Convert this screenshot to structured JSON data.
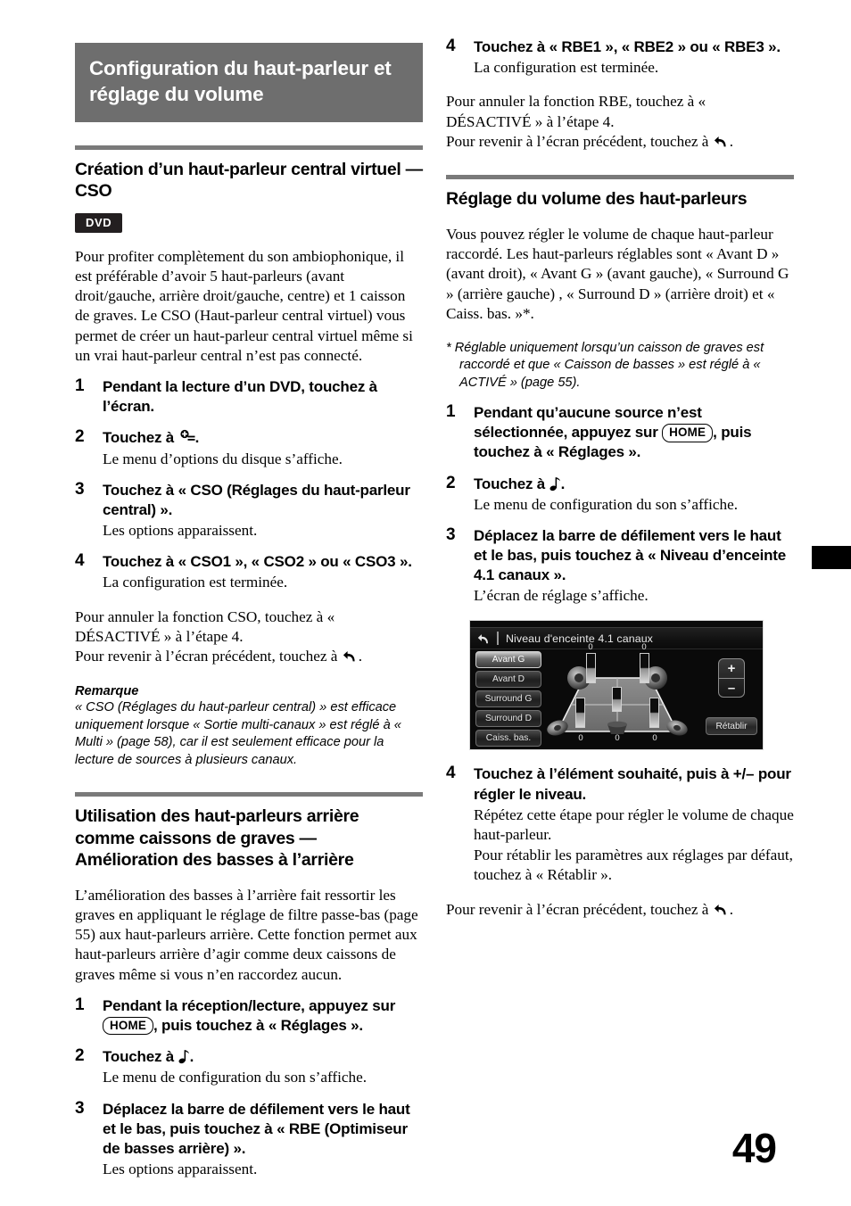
{
  "banner": {
    "title": "Configuration du haut-parleur et réglage du volume"
  },
  "left_column": {
    "section1": {
      "heading": "Création d’un haut-parleur central virtuel — CSO",
      "badge": "DVD",
      "intro": "Pour profiter complètement du son ambiophonique, il est préférable d’avoir 5 haut-parleurs (avant droit/gauche, arrière droit/gauche, centre) et 1 caisson de graves. Le CSO (Haut-parleur central virtuel) vous permet de créer un haut-parleur central virtuel même si un vrai haut-parleur central n’est pas connecté.",
      "steps": [
        {
          "num": "1",
          "lead": "Pendant la lecture d’un DVD, touchez à l’écran.",
          "sub": ""
        },
        {
          "num": "2",
          "lead_pre": "Touchez à",
          "lead_post": ".",
          "icon": "options-icon",
          "sub": "Le menu d’options du disque s’affiche."
        },
        {
          "num": "3",
          "lead": "Touchez à « CSO (Réglages du haut-parleur central) ».",
          "sub": "Les options apparaissent."
        },
        {
          "num": "4",
          "lead": "Touchez à « CSO1 », « CSO2 » ou « CSO3 ».",
          "sub": "La configuration est terminée."
        }
      ],
      "after_1": "Pour annuler la fonction CSO, touchez à « DÉSACTIVÉ » à l’étape 4.",
      "after_2_pre": "Pour revenir à l’écran précédent, touchez à",
      "after_2_post": ".",
      "note_title": "Remarque",
      "note_body": "« CSO (Réglages du haut-parleur central) » est efficace uniquement lorsque « Sortie multi-canaux » est réglé à « Multi » (page 58), car il est seulement efficace pour la lecture de sources à plusieurs canaux."
    },
    "section2": {
      "heading": "Utilisation des haut-parleurs arrière comme caissons de graves — Amélioration des basses à l’arrière",
      "intro": "L’amélioration des basses à l’arrière fait ressortir les graves en appliquant le réglage de filtre passe-bas (page 55) aux haut-parleurs arrière. Cette fonction permet aux haut-parleurs arrière d’agir comme deux caissons de graves même si vous n’en raccordez aucun.",
      "steps": [
        {
          "num": "1",
          "lead_a": "Pendant la réception/lecture, appuyez sur",
          "key": "HOME",
          "lead_b": ", puis touchez à « Réglages ».",
          "sub": ""
        },
        {
          "num": "2",
          "lead_pre": "Touchez à",
          "lead_post": ".",
          "icon": "music-note-icon",
          "sub": "Le menu de configuration du son s’affiche."
        },
        {
          "num": "3",
          "lead": "Déplacez la barre de défilement vers le haut et le bas, puis touchez à « RBE (Optimiseur de basses arrière) ».",
          "sub": "Les options apparaissent."
        }
      ]
    }
  },
  "right_column": {
    "continued_step": {
      "num": "4",
      "lead": "Touchez à « RBE1 », « RBE2 » ou « RBE3 ».",
      "sub": "La configuration est terminée."
    },
    "after_1": "Pour annuler la fonction RBE, touchez à « DÉSACTIVÉ » à l’étape 4.",
    "after_2_pre": "Pour revenir à l’écran précédent, touchez à",
    "after_2_post": ".",
    "section3": {
      "heading": "Réglage du volume des haut-parleurs",
      "intro": "Vous pouvez régler le volume de chaque haut-parleur raccordé. Les haut-parleurs réglables sont « Avant D » (avant droit), « Avant G » (avant gauche), « Surround G » (arrière gauche) , « Surround D » (arrière droit) et « Caiss. bas. »*.",
      "footnote": "* Réglable uniquement lorsqu’un caisson de graves est raccordé et que « Caisson de basses » est réglé à « ACTIVÉ » (page 55).",
      "steps": [
        {
          "num": "1",
          "lead_a": "Pendant qu’aucune source n’est sélectionnée, appuyez sur",
          "key": "HOME",
          "lead_b": ", puis touchez à « Réglages ».",
          "sub": ""
        },
        {
          "num": "2",
          "lead_pre": "Touchez à",
          "lead_post": ".",
          "icon": "music-note-icon",
          "sub": "Le menu de configuration du son s’affiche."
        },
        {
          "num": "3",
          "lead": "Déplacez la barre de défilement vers le haut et le bas, puis touchez à « Niveau d’enceinte 4.1 canaux ».",
          "sub": "L’écran de réglage s’affiche."
        }
      ],
      "step4": {
        "num": "4",
        "lead": "Touchez à l’élément souhaité, puis à +/– pour régler le niveau.",
        "sub1": "Répétez cette étape pour régler le volume de chaque haut-parleur.",
        "sub2": "Pour rétablir les paramètres aux réglages par défaut, touchez à « Rétablir »."
      },
      "closing_pre": "Pour revenir à l’écran précédent, touchez à",
      "closing_post": "."
    }
  },
  "device_screen": {
    "back_icon": "back-arrow-icon",
    "title": "Niveau d'enceinte 4.1 canaux",
    "speaker_buttons": [
      {
        "label": "Avant G",
        "selected": true
      },
      {
        "label": "Avant D",
        "selected": false
      },
      {
        "label": "Surround G",
        "selected": false
      },
      {
        "label": "Surround D",
        "selected": false
      },
      {
        "label": "Caiss. bas.",
        "selected": false
      }
    ],
    "level_values": {
      "front_left": "0",
      "front_right": "0",
      "surround_left": "0",
      "center_sub": "0",
      "surround_right": "0"
    },
    "plus_label": "+",
    "minus_label": "–",
    "reset_label": "Rétablir"
  },
  "folio": "49"
}
